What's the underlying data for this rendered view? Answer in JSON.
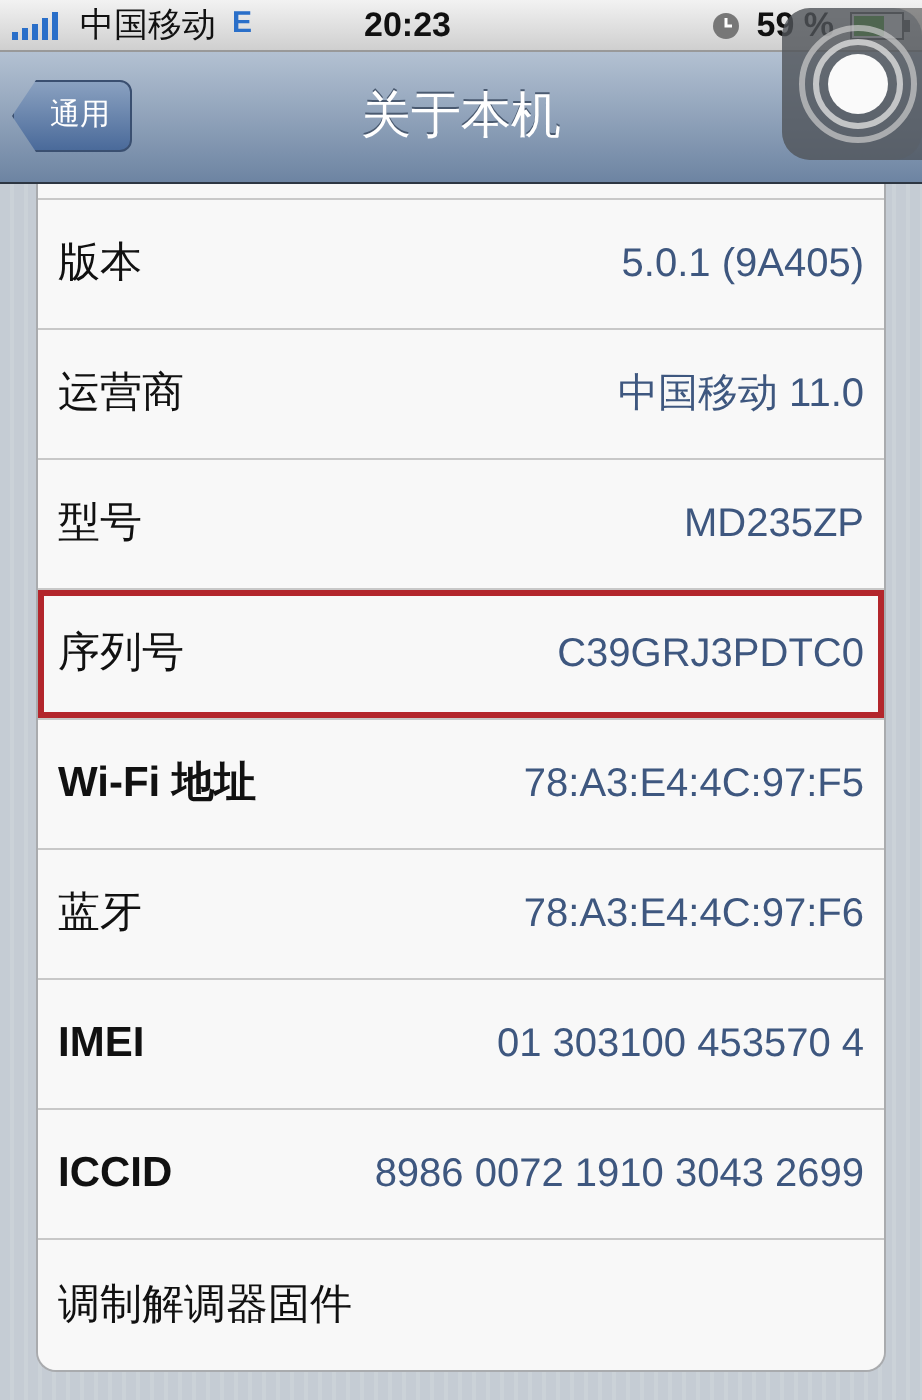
{
  "status_bar": {
    "carrier": "中国移动",
    "network": "E",
    "time": "20:23",
    "battery": "59 %"
  },
  "nav_bar": {
    "back": "通用",
    "title": "关于本机"
  },
  "rows": [
    {
      "label": "版本",
      "value": "5.0.1 (9A405)",
      "highlighted": false
    },
    {
      "label": "运营商",
      "value": "中国移动 11.0",
      "highlighted": false
    },
    {
      "label": "型号",
      "value": "MD235ZP",
      "highlighted": false
    },
    {
      "label": "序列号",
      "value": "C39GRJ3PDTC0",
      "highlighted": true
    },
    {
      "label": "Wi-Fi 地址",
      "value": "78:A3:E4:4C:97:F5",
      "highlighted": false
    },
    {
      "label": "蓝牙",
      "value": "78:A3:E4:4C:97:F6",
      "highlighted": false
    },
    {
      "label": "IMEI",
      "value": "01 303100 453570 4",
      "highlighted": false
    },
    {
      "label": "ICCID",
      "value": "8986 0072 1910 3043 2699",
      "highlighted": false
    },
    {
      "label": "调制解调器固件",
      "highlighted": false
    }
  ]
}
